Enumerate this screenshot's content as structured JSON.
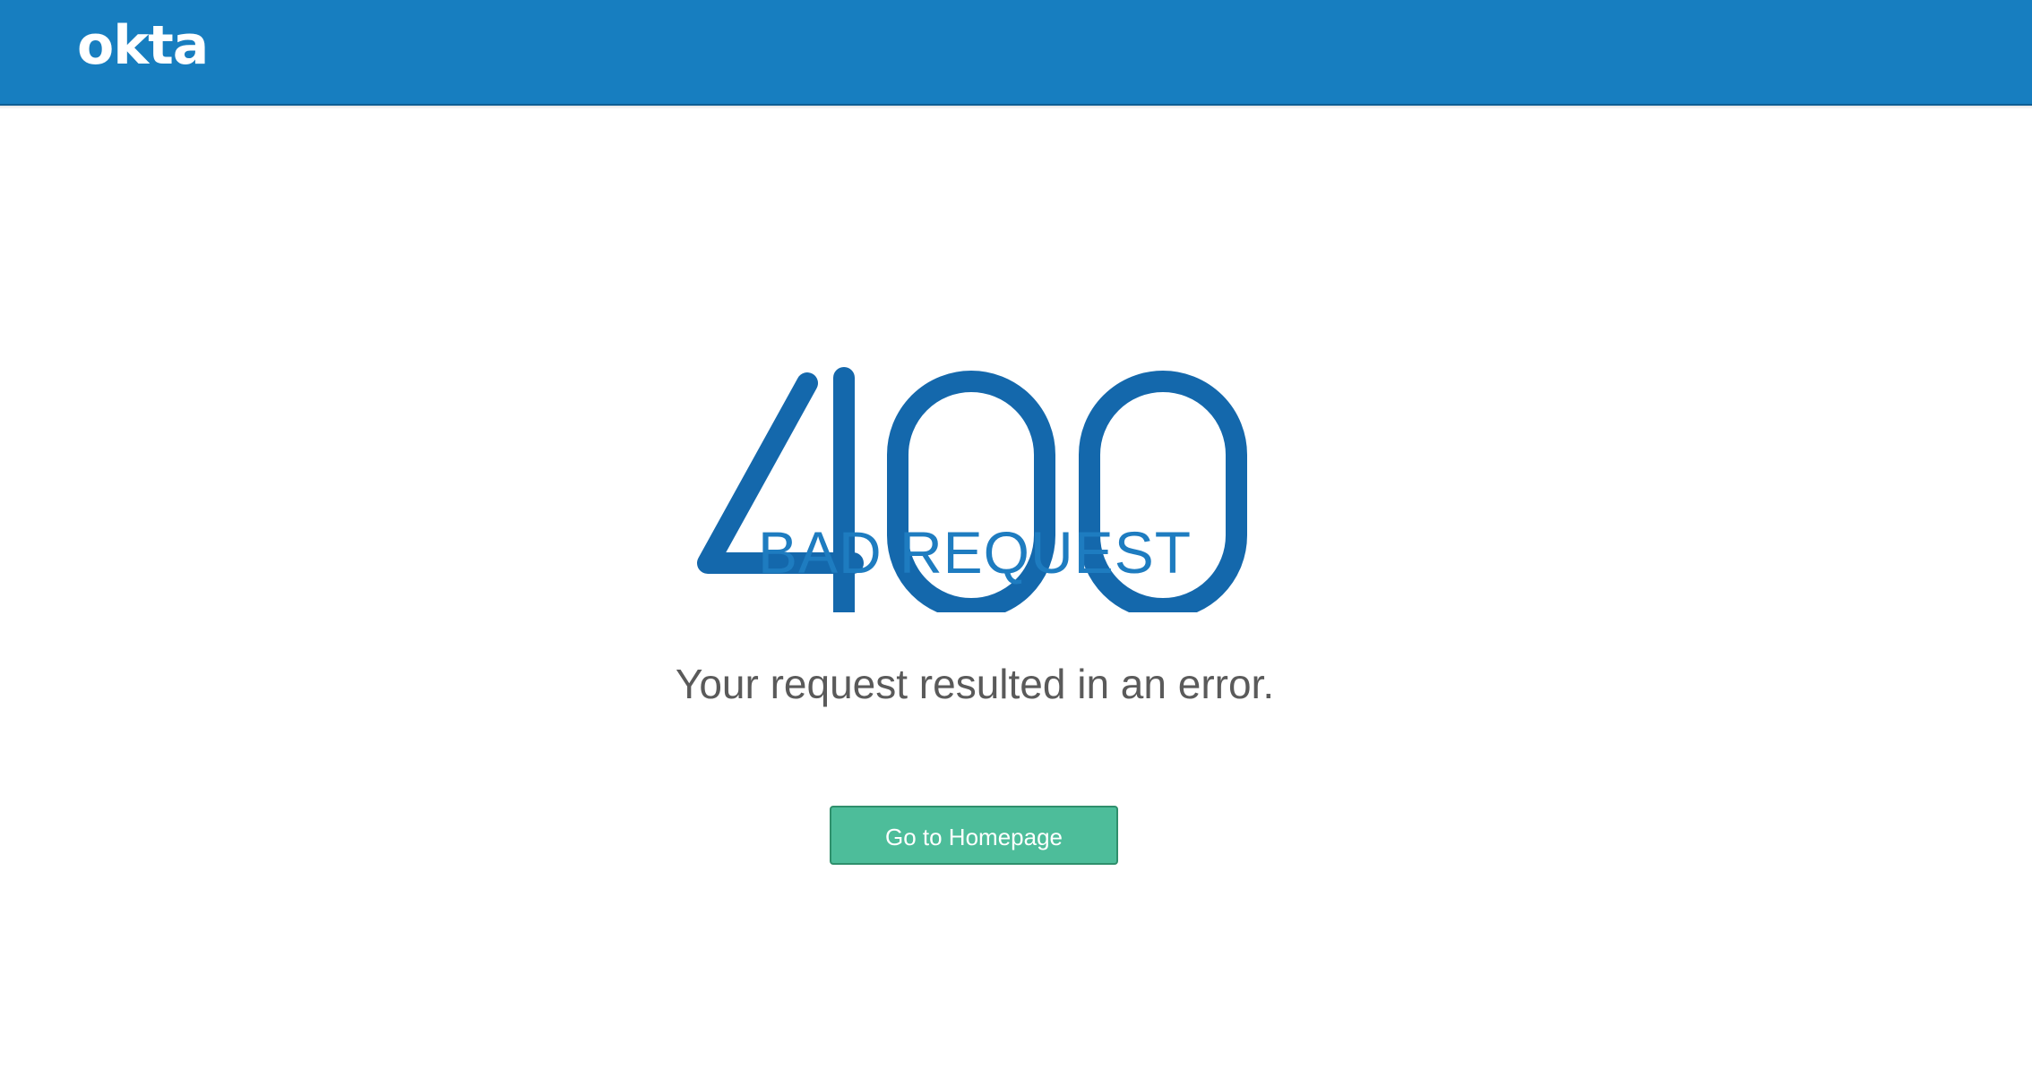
{
  "header": {
    "logo_text": "okta",
    "background_color": "#177ec0"
  },
  "error": {
    "code": "400",
    "title": "BAD REQUEST",
    "message": "Your request resulted in an error.",
    "accent_color": "#1e7cc0"
  },
  "actions": {
    "home_button_label": "Go to Homepage",
    "button_color": "#4dbd9a"
  }
}
